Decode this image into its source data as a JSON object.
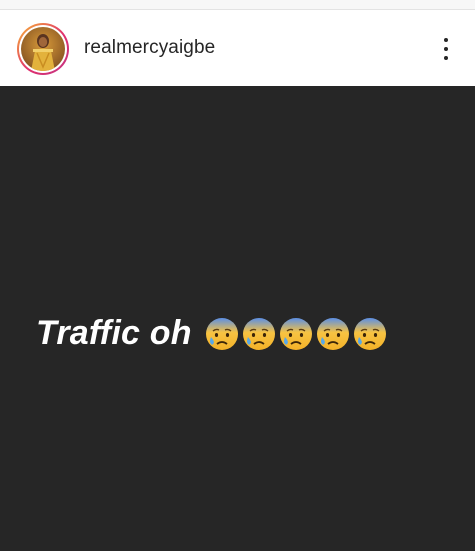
{
  "post": {
    "username": "realmercyaigbe",
    "avatar_icon": "profile-photo-icon",
    "more_icon": "more-vertical-icon"
  },
  "story": {
    "background_color": "#262626",
    "caption": "Traffic oh",
    "emojis": [
      "anxious-face-with-sweat-icon",
      "anxious-face-with-sweat-icon",
      "anxious-face-with-sweat-icon",
      "anxious-face-with-sweat-icon",
      "anxious-face-with-sweat-icon"
    ]
  }
}
